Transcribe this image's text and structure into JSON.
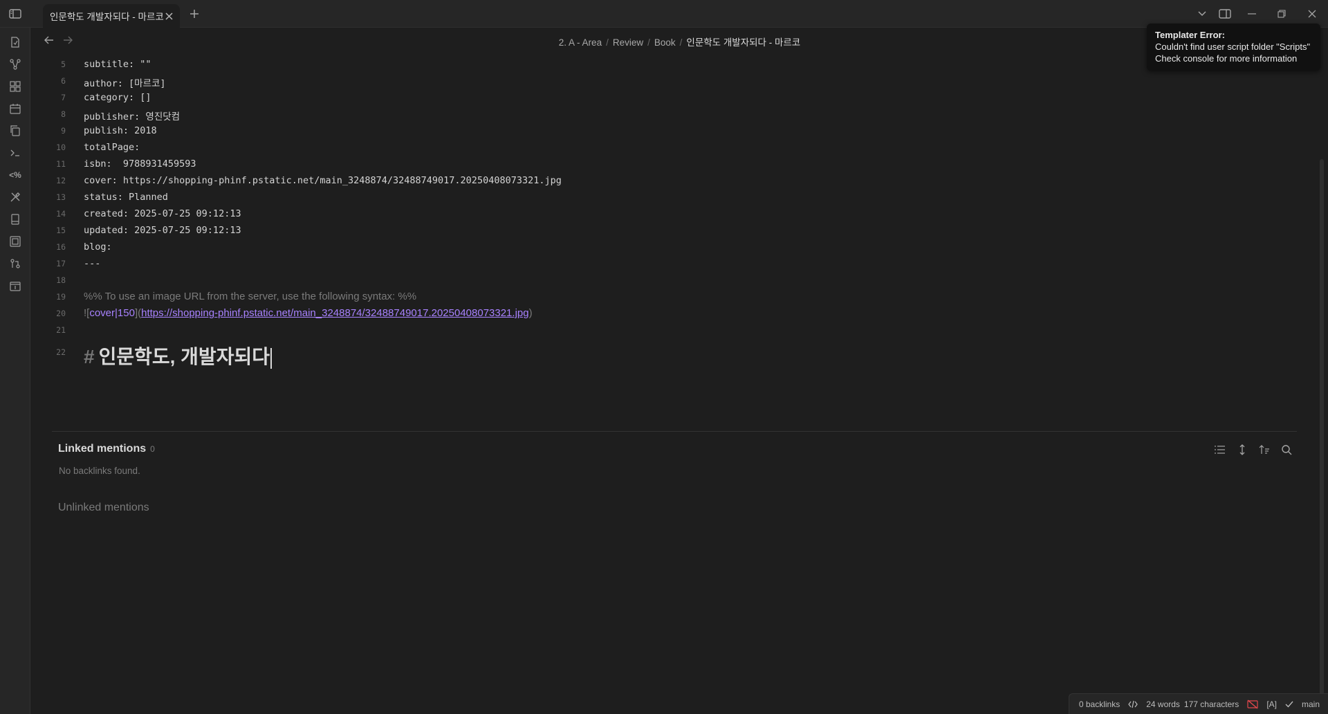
{
  "tab": {
    "title": "인문학도 개발자되다 - 마르코"
  },
  "breadcrumb": [
    "2. A - Area",
    "Review",
    "Book"
  ],
  "breadcrumb_current": "인문학도 개발자되다 - 마르코",
  "editor": {
    "lines": [
      {
        "num": "5",
        "text": "subtitle: \"\""
      },
      {
        "num": "6",
        "text": "author: [마르코]"
      },
      {
        "num": "7",
        "text": "category: []"
      },
      {
        "num": "8",
        "text": "publisher: 영진닷컴"
      },
      {
        "num": "9",
        "text": "publish: 2018"
      },
      {
        "num": "10",
        "text": "totalPage:"
      },
      {
        "num": "11",
        "text": "isbn:  9788931459593"
      },
      {
        "num": "12",
        "text": "cover: https://shopping-phinf.pstatic.net/main_3248874/32488749017.20250408073321.jpg"
      },
      {
        "num": "13",
        "text": "status: Planned"
      },
      {
        "num": "14",
        "text": "created: 2025-07-25 09:12:13"
      },
      {
        "num": "15",
        "text": "updated: 2025-07-25 09:12:13"
      },
      {
        "num": "16",
        "text": "blog:"
      },
      {
        "num": "17",
        "text": "---"
      },
      {
        "num": "18",
        "text": ""
      }
    ],
    "comment_num": "19",
    "comment": "%% To use an image URL from the server, use the following syntax: %%",
    "image_num": "20",
    "image_prefix": "![",
    "image_alt": "cover|150",
    "image_mid": "](",
    "image_url": "https://shopping-phinf.pstatic.net/main_3248874/32488749017.20250408073321.jpg",
    "image_suffix": ")",
    "blank_num": "21",
    "heading_num": "22",
    "heading_hash": "#",
    "heading": "인문학도, 개발자되다"
  },
  "backlinks": {
    "linked_title": "Linked mentions",
    "linked_count": "0",
    "linked_empty": "No backlinks found.",
    "unlinked_title": "Unlinked mentions"
  },
  "notice": {
    "title": "Templater Error:",
    "line1": "Couldn't find user script folder \"Scripts\"",
    "line2": "Check console for more information"
  },
  "status": {
    "backlinks": "0 backlinks",
    "words": "24 words",
    "characters": "177 characters",
    "vim_mode": "[A]",
    "branch": "main"
  }
}
